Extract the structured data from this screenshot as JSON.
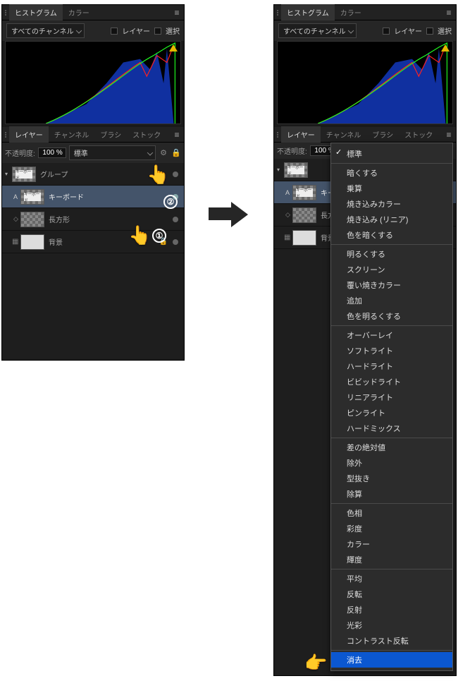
{
  "tabs_top": {
    "histogram": "ヒストグラム",
    "color": "カラー"
  },
  "histo": {
    "all_channels": "すべてのチャンネル",
    "layer_chk": "レイヤー",
    "select_chk": "選択"
  },
  "tabs_layers": {
    "layers": "レイヤー",
    "channels": "チャンネル",
    "brushes": "ブラシ",
    "stock": "ストック"
  },
  "layer_ctrl": {
    "opacity_label": "不透明度:",
    "opacity_value": "100 %",
    "blend_current": "標準"
  },
  "layers": {
    "group": "グループ",
    "keyboard": "キーボード",
    "rect": "長方形",
    "bg": "背景",
    "thumb_kb": "キーボード"
  },
  "right_menu_layers": {
    "keyboard_short": "キー",
    "rect_short": "長方"
  },
  "annotations": {
    "num1": "①",
    "num2": "②"
  },
  "blend_modes": {
    "normal": "標準",
    "darken": "暗くする",
    "multiply": "乗算",
    "color_burn": "焼き込みカラー",
    "linear_burn": "焼き込み (リニア)",
    "darker_color": "色を暗くする",
    "lighten": "明るくする",
    "screen": "スクリーン",
    "color_dodge": "覆い焼きカラー",
    "add": "追加",
    "lighter_color": "色を明るくする",
    "overlay": "オーバーレイ",
    "soft_light": "ソフトライト",
    "hard_light": "ハードライト",
    "vivid_light": "ビビッドライト",
    "linear_light": "リニアライト",
    "pin_light": "ピンライト",
    "hard_mix": "ハードミックス",
    "difference": "差の絶対値",
    "exclusion": "除外",
    "subtract": "型抜き",
    "divide": "除算",
    "hue": "色相",
    "saturation": "彩度",
    "color": "カラー",
    "luminosity": "輝度",
    "average": "平均",
    "negation": "反転",
    "reflect": "反射",
    "glow": "光彩",
    "contrast_negate": "コントラスト反転",
    "erase": "消去"
  }
}
